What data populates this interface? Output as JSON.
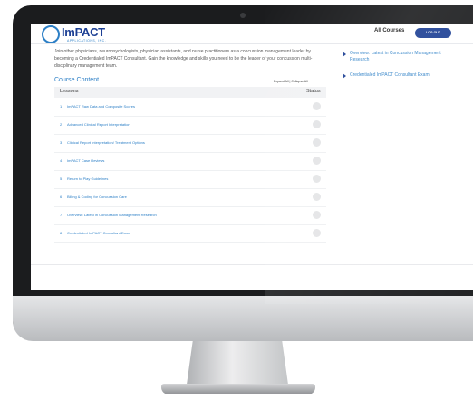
{
  "header": {
    "logo_text": "ImPACT",
    "logo_sub": "APPLICATIONS, INC.",
    "all_courses_label": "All Courses",
    "logout_label": "LOG OUT"
  },
  "intro_text": "Join other physicians, neuropsychologists, physician assistants, and nurse practitioners as a concussion management leader by becoming a Credentialed ImPACT Consultant. Gain the knowledge and skills you need to be the leader of your concussion multi-disciplinary management team.",
  "course_content": {
    "title": "Course Content",
    "controls": "Expand All | Collapse All",
    "col_lessons": "Lessons",
    "col_status": "Status",
    "lessons": [
      {
        "num": "1",
        "title": "ImPACT Raw Data and Composite Scores"
      },
      {
        "num": "2",
        "title": "Advanced Clinical Report Interpretation"
      },
      {
        "num": "3",
        "title": "Clinical Report Interpretation/ Treatment Options"
      },
      {
        "num": "4",
        "title": "ImPACT Case Reviews"
      },
      {
        "num": "5",
        "title": "Return to Play Guidelines"
      },
      {
        "num": "6",
        "title": "Billing & Coding for Concussion Care"
      },
      {
        "num": "7",
        "title": "Overview: Latest in Concussion Management Research"
      },
      {
        "num": "8",
        "title": "Credentialed ImPACT Consultant Exam"
      }
    ]
  },
  "sidebar": {
    "items": [
      {
        "label": "Overview: Latest in Concussion Management Research"
      },
      {
        "label": "Credentialed ImPACT Consultant Exam"
      }
    ]
  },
  "colors": {
    "brand_navy": "#1c3f94",
    "link_blue": "#2c7fc6",
    "bezel": "#1b1c1e"
  }
}
